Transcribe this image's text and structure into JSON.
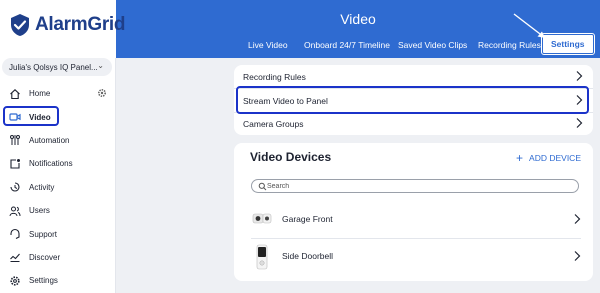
{
  "brand": {
    "name": "AlarmGrid"
  },
  "header": {
    "title": "Video"
  },
  "tabs": [
    {
      "label": "Live Video"
    },
    {
      "label": "Onboard 24/7 Timeline"
    },
    {
      "label": "Saved Video Clips"
    },
    {
      "label": "Recording Rules"
    },
    {
      "label": "Settings",
      "active": true
    }
  ],
  "sidebar": {
    "panel_select": "Julia's Qolsys IQ Panel...",
    "items": [
      {
        "label": "Home",
        "icon": "home-icon"
      },
      {
        "label": "Video",
        "icon": "video-camera-icon",
        "active": true
      },
      {
        "label": "Automation",
        "icon": "automation-icon"
      },
      {
        "label": "Notifications",
        "icon": "notifications-icon"
      },
      {
        "label": "Activity",
        "icon": "activity-icon"
      },
      {
        "label": "Users",
        "icon": "users-icon"
      },
      {
        "label": "Support",
        "icon": "support-icon"
      },
      {
        "label": "Discover",
        "icon": "discover-icon"
      },
      {
        "label": "Settings",
        "icon": "gear-icon"
      }
    ]
  },
  "settings_list": {
    "items": [
      {
        "label": "Recording Rules"
      },
      {
        "label": "Stream Video to Panel"
      },
      {
        "label": "Camera Groups"
      }
    ]
  },
  "video_devices": {
    "title": "Video Devices",
    "add_label": "ADD DEVICE",
    "search_placeholder": "Search",
    "devices": [
      {
        "name": "Garage Front",
        "icon": "outdoor-camera-icon"
      },
      {
        "name": "Side Doorbell",
        "icon": "doorbell-camera-icon"
      }
    ]
  },
  "colors": {
    "accent": "#2f6bd1",
    "highlight": "#1b33c9",
    "background": "#eef0f4"
  }
}
